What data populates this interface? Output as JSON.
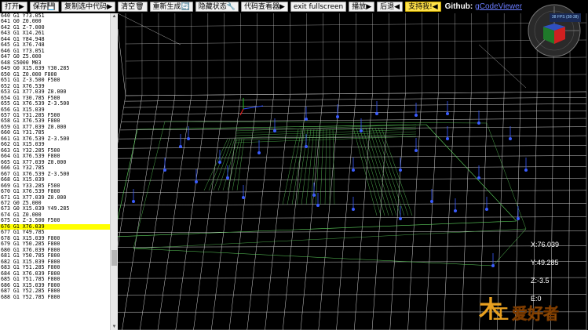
{
  "toolbar": {
    "buttons": [
      "打开▶",
      "保存💾",
      "复制选中代码▶",
      "清空🗑",
      "重新生成🔄",
      "隐藏状态🔧",
      "代码查看器▶",
      "exit fullscreen",
      "播放▶",
      "后退◀",
      "支持我!◀"
    ],
    "github_label": "Github:",
    "github_link": "gCodeViewer"
  },
  "code": {
    "lines": [
      "640 G1 Y73.051",
      "641 G0 Z0.000",
      "642 G1 Z-7.000",
      "643 G1 X14.261",
      "644 G1 Y84.948",
      "645 G1 X76.748",
      "646 G1 Y73.051",
      "647 G0 Z5.000",
      "648 S5000 M03",
      "649 G0 X15.039 Y30.285",
      "650 G1 Z0.000 F800",
      "651 G1 Z-3.500 F500",
      "652 G1 X76.539",
      "653 G1 X77.039 Z0.000",
      "654 G1 Y30.785 F500",
      "655 G1 X76.539 Z-3.500",
      "656 G1 X15.039",
      "657 G1 Y31.285 F500",
      "658 G1 X76.539 F800",
      "659 G1 X77.039 Z0.000",
      "660 G1 Y31.785",
      "661 G1 X76.539 Z-3.500",
      "662 G1 X15.039",
      "663 G1 Y32.285 F500",
      "664 G1 X76.539 F800",
      "665 G1 X77.039 Z0.000",
      "666 G1 Y32.785",
      "667 G1 X76.539 Z-3.500",
      "668 G1 X15.039",
      "669 G1 Y33.285 F500",
      "670 G1 X76.539 F800",
      "671 G1 X77.039 Z0.000",
      "672 G0 Z5.000",
      "673 G0 X15.039 Y49.285",
      "674 G1 Z0.000",
      "675 G1 Z-3.500 F500",
      "676 G1 X76.039",
      "677 G1 Y49.785",
      "678 G1 X15.039 F800",
      "679 G1 Y50.285 F800",
      "680 G1 X76.039 F800",
      "681 G1 Y50.785 F800",
      "682 G1 X15.039 F800",
      "683 G1 Y51.285 F800",
      "684 G1 X76.039 F800",
      "685 G1 Y51.785 F800",
      "686 G1 X15.039 F800",
      "687 G1 Y52.285 F800",
      "688 G1 Y52.785 F800"
    ],
    "highlight_index": 36
  },
  "readout": {
    "x": "X:76.039",
    "y": "Y:49.285",
    "z": "Z:-3.5",
    "e": "E:0"
  },
  "fps": "38 FPS (38-38)",
  "logo_text": "爱好者",
  "colors": {
    "grid": "#cfcfcf",
    "toolpath": "#5fd45f",
    "plunge": "#3a5cff",
    "highlight": "#ffff00",
    "logo": "#e8a020"
  }
}
